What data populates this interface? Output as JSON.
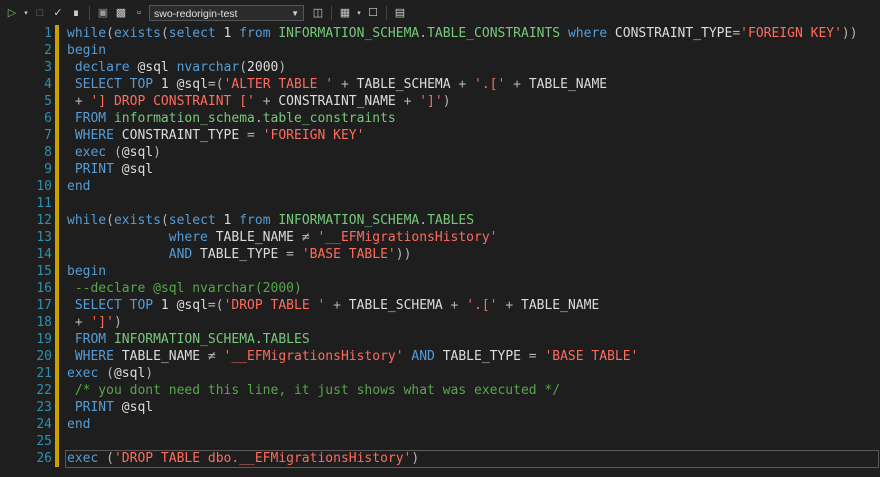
{
  "toolbar": {
    "database": "swo-redorigin-test",
    "icons": [
      "execute-icon",
      "dropdown-icon",
      "stop-icon",
      "parse-check-icon",
      "display-plan-icon",
      "connect-icon",
      "disconnect-icon",
      "change-connection-icon",
      "database-dropdown-icon",
      "query-options-icon",
      "results-grid-icon",
      "results-dropdown-icon",
      "include-plan-icon",
      "sqlcmd-mode-icon"
    ]
  },
  "editor": {
    "line_numbers": [
      "1",
      "2",
      "3",
      "4",
      "5",
      "6",
      "7",
      "8",
      "9",
      "10",
      "11",
      "12",
      "13",
      "14",
      "15",
      "16",
      "17",
      "18",
      "19",
      "20",
      "21",
      "22",
      "23",
      "24",
      "25",
      "26"
    ],
    "current_line": 26,
    "lines": [
      "while(exists(select 1 from INFORMATION_SCHEMA.TABLE_CONSTRAINTS where CONSTRAINT_TYPE='FOREIGN KEY'))",
      "begin",
      " declare @sql nvarchar(2000)",
      " SELECT TOP 1 @sql=('ALTER TABLE ' + TABLE_SCHEMA + '.[' + TABLE_NAME",
      " + '] DROP CONSTRAINT [' + CONSTRAINT_NAME + ']')",
      " FROM information_schema.table_constraints",
      " WHERE CONSTRAINT_TYPE = 'FOREIGN KEY'",
      " exec (@sql)",
      " PRINT @sql",
      "end",
      "",
      "while(exists(select 1 from INFORMATION_SCHEMA.TABLES",
      "             where TABLE_NAME ≠ '__EFMigrationsHistory'",
      "             AND TABLE_TYPE = 'BASE TABLE'))",
      "begin",
      " --declare @sql nvarchar(2000)",
      " SELECT TOP 1 @sql=('DROP TABLE ' + TABLE_SCHEMA + '.[' + TABLE_NAME",
      " + ']')",
      " FROM INFORMATION_SCHEMA.TABLES",
      " WHERE TABLE_NAME ≠ '__EFMigrationsHistory' AND TABLE_TYPE = 'BASE TABLE'",
      "exec (@sql)",
      " /* you dont need this line, it just shows what was executed */",
      " PRINT @sql",
      "end",
      "",
      "exec ('DROP TABLE dbo.__EFMigrationsHistory')"
    ]
  }
}
